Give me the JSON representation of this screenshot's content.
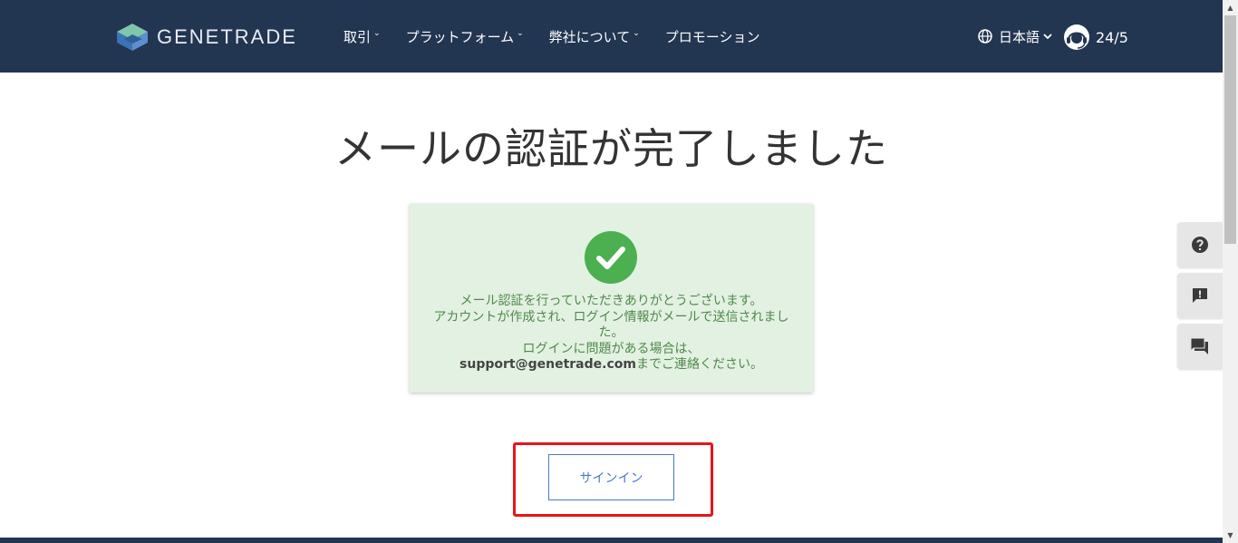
{
  "brand": {
    "name": "GENETRADE"
  },
  "nav": {
    "items": [
      {
        "label": "取引",
        "has_dropdown": true
      },
      {
        "label": "プラットフォーム",
        "has_dropdown": true
      },
      {
        "label": "弊社について",
        "has_dropdown": true
      },
      {
        "label": "プロモーション",
        "has_dropdown": false
      }
    ]
  },
  "header_right": {
    "language": "日本語",
    "support_hours": "24/5"
  },
  "main": {
    "title": "メールの認証が完了しました",
    "message": {
      "line1": "メール認証を行っていただきありがとうございます。",
      "line2": "アカウントが作成され、ログイン情報がメールで送信されました。",
      "line3": "ログインに問題がある場合は、",
      "email": "support@genetrade.com",
      "line4_suffix": "までご連絡ください。"
    },
    "signin_label": "サインイン"
  },
  "side_buttons": [
    {
      "icon": "help-icon"
    },
    {
      "icon": "feedback-icon"
    },
    {
      "icon": "chat-icon"
    }
  ],
  "colors": {
    "header_bg": "#223551",
    "success_bg": "#e3f1e2",
    "success_green": "#4caf50",
    "message_text": "#4f8a4b",
    "link_blue": "#4a79c4",
    "highlight_red": "#e8141c"
  }
}
